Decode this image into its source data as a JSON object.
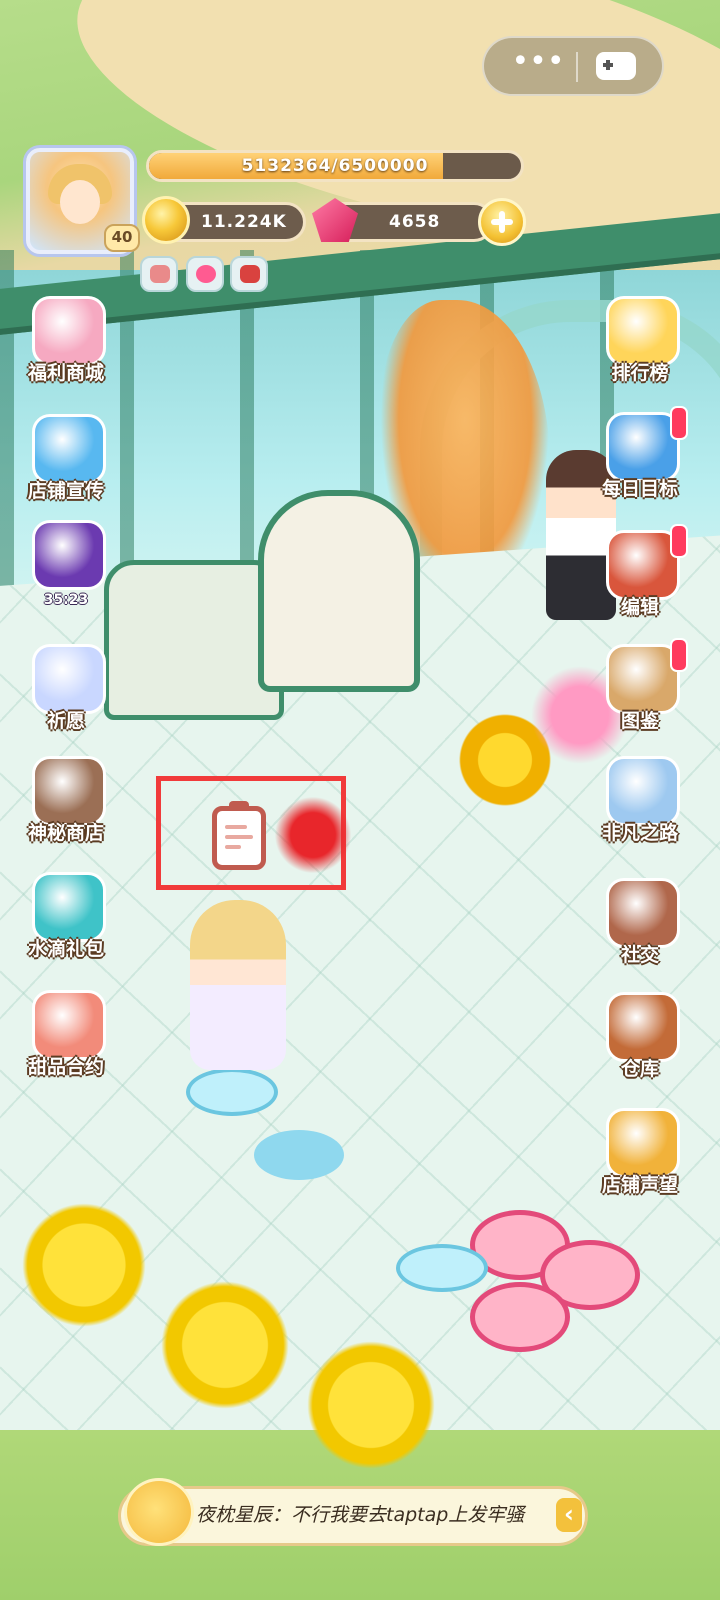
{
  "player": {
    "level": "40"
  },
  "stats": {
    "xp_text": "5132364/6500000",
    "xp_fraction": 0.79,
    "coins": "11.224K",
    "gems": "4658"
  },
  "capsule": {
    "menu_glyph": "•••"
  },
  "left_menu": [
    {
      "key": "welfare_shop",
      "label": "福利商城",
      "icon": "vip-shop-icon",
      "color": "#f6a9c1"
    },
    {
      "key": "store_promo",
      "label": "店铺宣传",
      "icon": "camera-icon",
      "color": "#58b8f0"
    },
    {
      "key": "mystery_book",
      "label": "",
      "icon": "mystery-book-icon",
      "color": "#6b3ab0",
      "timer": "35:23"
    },
    {
      "key": "wish",
      "label": "祈愿",
      "icon": "moon-crystal-icon",
      "color": "#c9d7ff"
    },
    {
      "key": "mystery_shop",
      "label": "神秘商店",
      "icon": "shopkeeper-portrait-icon",
      "color": "#9b6f55"
    },
    {
      "key": "water_gift",
      "label": "水滴礼包",
      "icon": "water-gift-icon",
      "color": "#3fc3c8"
    },
    {
      "key": "dessert_contract",
      "label": "甜品合约",
      "icon": "dessert-scroll-icon",
      "color": "#f28b7a"
    }
  ],
  "right_menu": [
    {
      "key": "leaderboard",
      "label": "排行榜",
      "icon": "podium-icon",
      "color": "#ffd55a"
    },
    {
      "key": "daily_goal",
      "label": "每日目标",
      "icon": "calendar-icon",
      "color": "#4aa0e8",
      "alert": true
    },
    {
      "key": "edit",
      "label": "编辑",
      "icon": "hammer-toolbox-icon",
      "color": "#d9563c",
      "alert": true
    },
    {
      "key": "catalog",
      "label": "图鉴",
      "icon": "open-book-icon",
      "color": "#d9a86a",
      "alert": true
    },
    {
      "key": "extraordinary_road",
      "label": "非凡之路",
      "icon": "map-tile-icon",
      "color": "#9ec9f0"
    },
    {
      "key": "social",
      "label": "社交",
      "icon": "friends-icon",
      "color": "#b0674b"
    },
    {
      "key": "warehouse",
      "label": "仓库",
      "icon": "warehouse-icon",
      "color": "#c36b38"
    },
    {
      "key": "store_reputation",
      "label": "店铺声望",
      "icon": "cupcake-icon",
      "color": "#f1b23a"
    }
  ],
  "chat": {
    "message": "夜枕星辰：不行我要去taptap上发牢骚",
    "arrow": "‹"
  }
}
